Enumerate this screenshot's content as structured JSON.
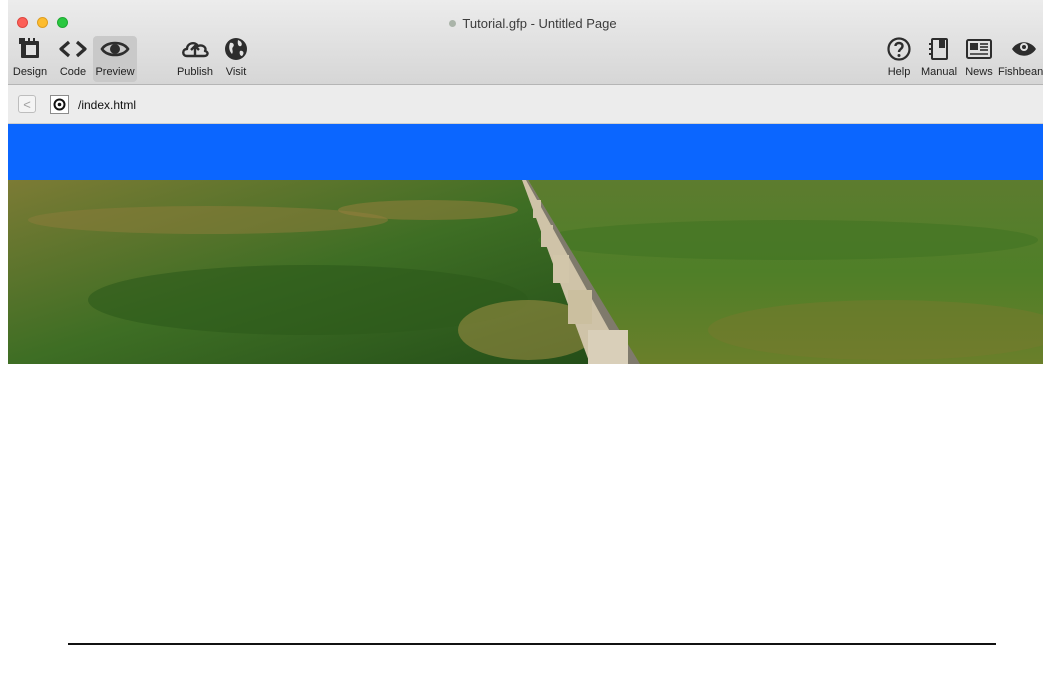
{
  "window": {
    "title": "Tutorial.gfp - Untitled Page"
  },
  "toolbar": {
    "left": [
      {
        "label": "Design",
        "icon": "design-icon"
      },
      {
        "label": "Code",
        "icon": "code-icon"
      },
      {
        "label": "Preview",
        "icon": "eye-icon",
        "active": true
      },
      {
        "label": "Publish",
        "icon": "cloud-upload-icon"
      },
      {
        "label": "Visit",
        "icon": "globe-icon"
      }
    ],
    "right": [
      {
        "label": "Help",
        "icon": "help-icon"
      },
      {
        "label": "Manual",
        "icon": "manual-icon"
      },
      {
        "label": "News",
        "icon": "news-icon"
      },
      {
        "label": "Fishbean",
        "icon": "fishbean-icon"
      }
    ]
  },
  "navbar": {
    "back_glyph": "<",
    "url": "/index.html"
  },
  "page": {
    "banner_color": "#0b66ff",
    "hero_image": "grassland-with-wooden-fence"
  }
}
